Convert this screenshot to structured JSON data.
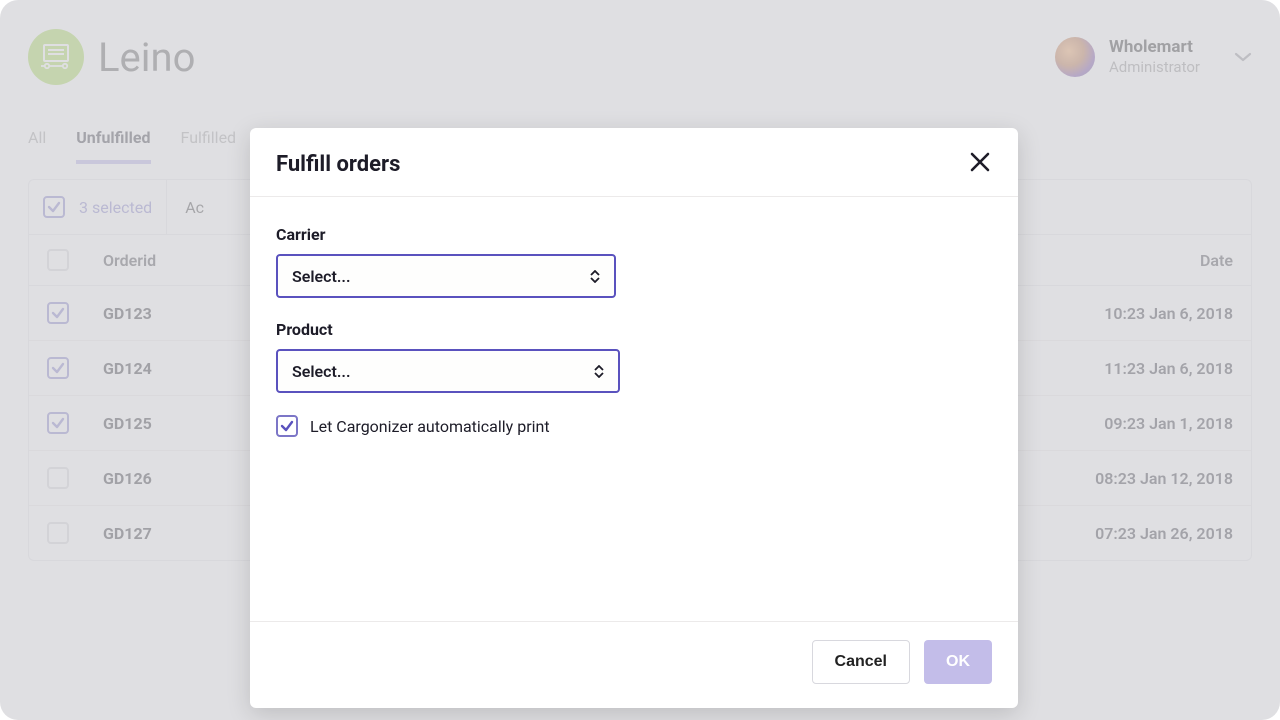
{
  "brand": {
    "name": "Leino"
  },
  "user": {
    "company": "Wholemart",
    "role": "Administrator"
  },
  "tabs": {
    "all": "All",
    "unfulfilled": "Unfulfilled",
    "fulfilled": "Fulfilled"
  },
  "selection": {
    "count_label": "3 selected",
    "actions_stub": "Ac"
  },
  "columns": {
    "orderid": "Orderid",
    "date": "Date"
  },
  "orders": [
    {
      "id": "GD123",
      "date": "10:23 Jan 6, 2018",
      "checked": true
    },
    {
      "id": "GD124",
      "date": "11:23 Jan 6, 2018",
      "checked": true
    },
    {
      "id": "GD125",
      "date": "09:23 Jan 1, 2018",
      "checked": true
    },
    {
      "id": "GD126",
      "date": "08:23 Jan 12, 2018",
      "checked": false
    },
    {
      "id": "GD127",
      "date": "07:23 Jan 26, 2018",
      "checked": false
    }
  ],
  "modal": {
    "title": "Fulfill orders",
    "carrier_label": "Carrier",
    "product_label": "Product",
    "select_placeholder": "Select...",
    "auto_print_label": "Let Cargonizer automatically print",
    "auto_print_checked": true,
    "cancel_label": "Cancel",
    "ok_label": "OK"
  }
}
